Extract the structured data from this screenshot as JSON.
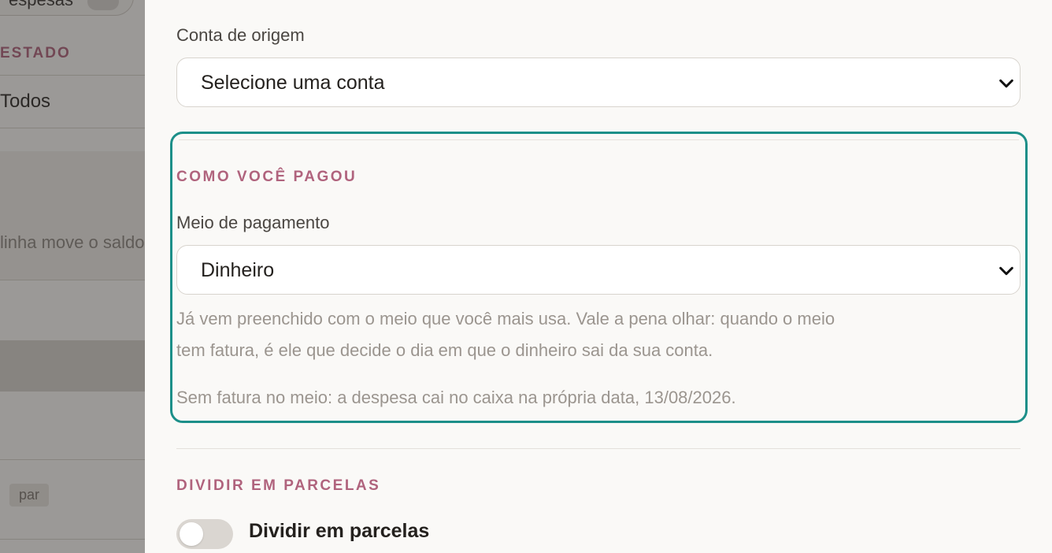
{
  "background": {
    "filter_pill_text": "espesas",
    "section_estado": "ESTADO",
    "estado_value": "Todos",
    "hint_text": "linha move o saldo",
    "chip_text": "par"
  },
  "form": {
    "conta_origem": {
      "label": "Conta de origem",
      "value": "Selecione uma conta"
    },
    "pagamento": {
      "section_title": "COMO VOCÊ PAGOU",
      "label": "Meio de pagamento",
      "value": "Dinheiro",
      "help_line1": "Já vem preenchido com o meio que você mais usa. Vale a pena olhar: quando o meio",
      "help_line2": "tem fatura, é ele que decide o dia em que o dinheiro sai da sua conta.",
      "note": "Sem fatura no meio: a despesa cai no caixa na própria data, 13/08/2026."
    },
    "parcelas": {
      "section_title": "DIVIDIR EM PARCELAS",
      "toggle_label": "Dividir em parcelas",
      "toggle_on": false
    }
  },
  "colors": {
    "accent": "#b0637d",
    "focus_border": "#1c8f89",
    "panel_bg": "#faf9f7"
  }
}
